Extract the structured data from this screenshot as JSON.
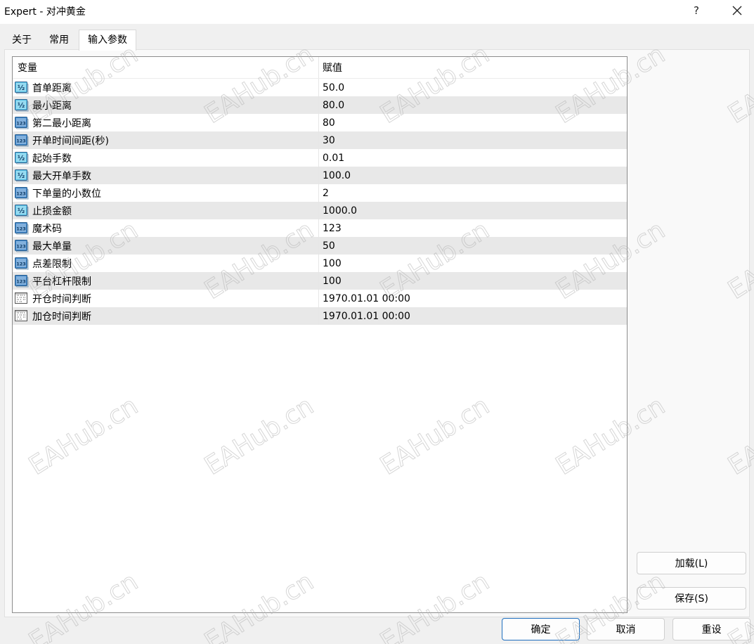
{
  "window": {
    "title": "Expert - 对冲黄金",
    "help_glyph": "?"
  },
  "tabs": [
    {
      "label": "关于"
    },
    {
      "label": "常用"
    },
    {
      "label": "输入参数",
      "active": true
    }
  ],
  "grid": {
    "columns": [
      "变量",
      "赋值"
    ],
    "rows": [
      {
        "type": "double",
        "name": "首单距离",
        "value": "50.0"
      },
      {
        "type": "double",
        "name": "最小距离",
        "value": "80.0"
      },
      {
        "type": "int",
        "name": "第二最小距离",
        "value": "80"
      },
      {
        "type": "int",
        "name": "开单时间间距(秒)",
        "value": "30"
      },
      {
        "type": "double",
        "name": "起始手数",
        "value": "0.01"
      },
      {
        "type": "double",
        "name": "最大开单手数",
        "value": "100.0"
      },
      {
        "type": "int",
        "name": "下单量的小数位",
        "value": "2"
      },
      {
        "type": "double",
        "name": "止损金额",
        "value": "1000.0"
      },
      {
        "type": "int",
        "name": "魔术码",
        "value": "123"
      },
      {
        "type": "int",
        "name": "最大单量",
        "value": "50"
      },
      {
        "type": "int",
        "name": "点差限制",
        "value": "100"
      },
      {
        "type": "int",
        "name": "平台杠杆限制",
        "value": "100"
      },
      {
        "type": "datetime",
        "name": "开仓时间判断",
        "value": "1970.01.01 00:00"
      },
      {
        "type": "datetime",
        "name": "加仓时间判断",
        "value": "1970.01.01 00:00"
      }
    ]
  },
  "icons": {
    "double": "fraction-icon",
    "int": "integer-icon",
    "datetime": "calendar-icon",
    "double_glyph": "½",
    "int_glyph": "123"
  },
  "side_buttons": {
    "load": "加载(L)",
    "save": "保存(S)"
  },
  "bottom_buttons": {
    "ok": "确定",
    "cancel": "取消",
    "reset": "重设"
  },
  "watermark": "EAHub.cn",
  "colors": {
    "row_alt": "#e8e8e8",
    "ok_border": "#1f6fbf",
    "icon_double_fill": "#5ec6e8",
    "icon_int_fill": "#3f86c9"
  }
}
